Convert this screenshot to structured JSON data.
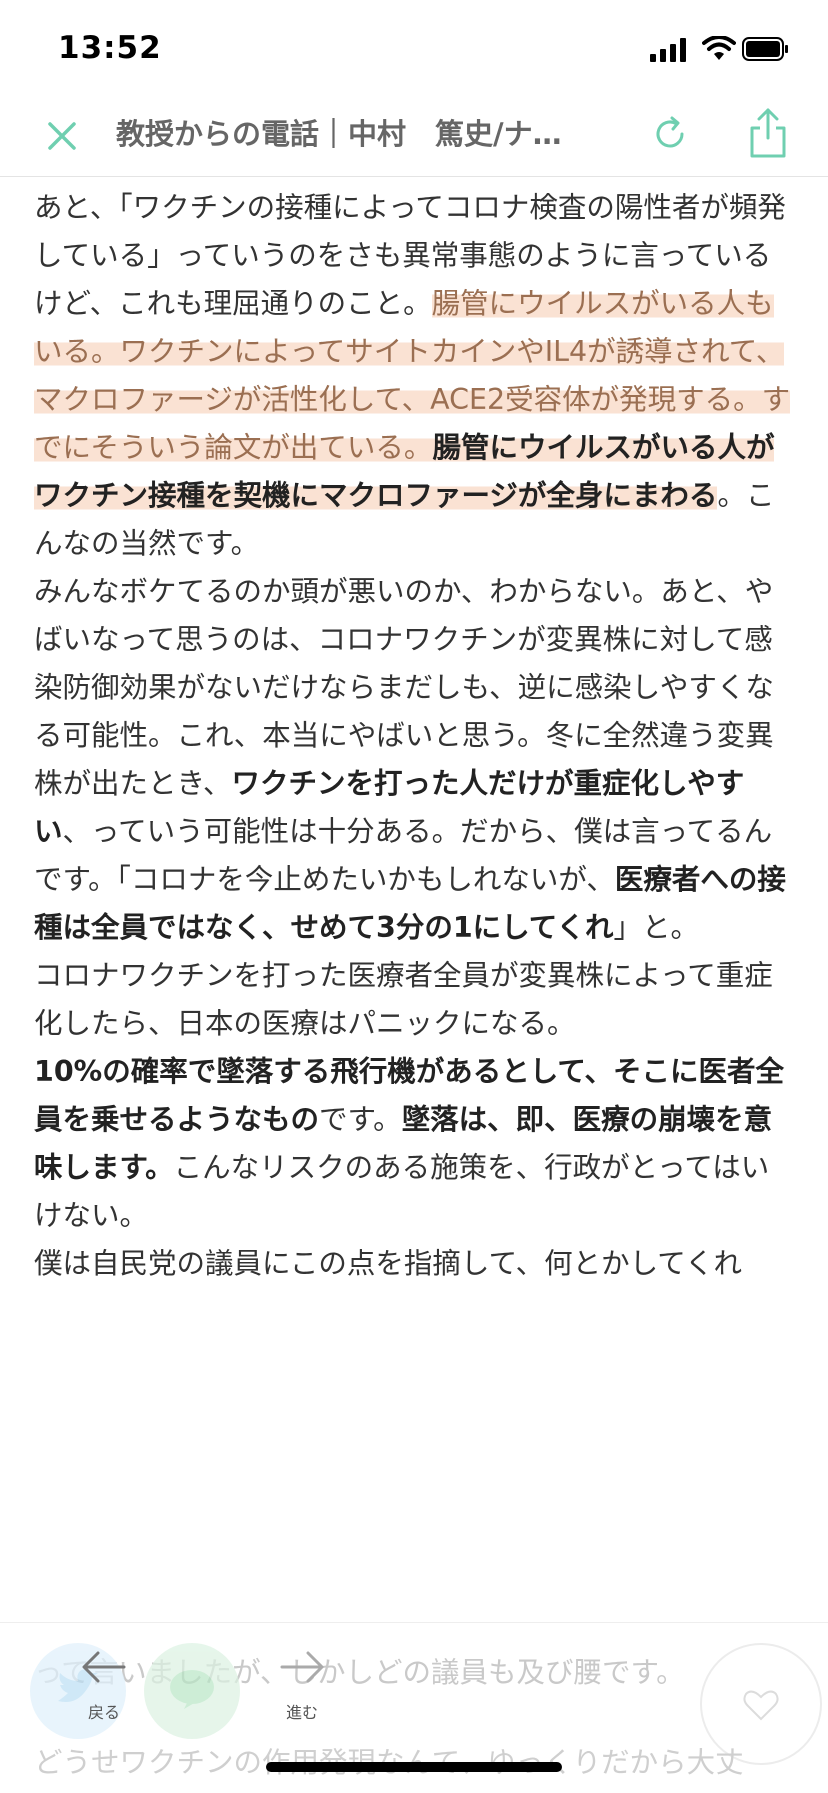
{
  "status_bar": {
    "time": "13:52"
  },
  "nav": {
    "title": "教授からの電話｜中村　篤史/ナ…"
  },
  "article": {
    "p1": {
      "a": "あと、「ワクチンの接種によってコロナ検査の陽性者が頻発している」っていうのをさも異常事態のように言っているけど、これも理屈通りのこと。",
      "b": "腸管にウイルスがいる人もいる。ワクチンによってサイトカインやIL4が誘導されて、マクロファージが活性化して、ACE2受容体が発現する。すでにそういう論文が出ている。",
      "c": "腸管にウイルスがいる人がワクチン接種を契機にマクロファージが全身にまわる",
      "d": "。こんなの当然です。"
    },
    "p2": {
      "a": "みんなボケてるのか頭が悪いのか、わからない。あと、やばいなって思うのは、コロナワクチンが変異株に対して感染防御効果がないだけならまだしも、逆に感染しやすくなる可能性。これ、本当にやばいと思う。冬に全然違う変異株が出たとき、",
      "b": "ワクチンを打った人だけが重症化しやすい",
      "c": "、っていう可能性は十分ある。だから、僕は言ってるんです。「コロナを今止めたいかもしれないが、",
      "d": "医療者への接種は全員ではなく、せめて3分の1にしてくれ",
      "e": "」と。"
    },
    "p3": "コロナワクチンを打った医療者全員が変異株によって重症化したら、日本の医療はパニックになる。",
    "p4": {
      "a": "10%の確率で墜落する飛行機があるとして、そこに医者全員を乗せるようなもの",
      "b": "です。",
      "c": "墜落は、即、医療の崩壊を意味します。",
      "d": "こんなリスクのある施策を、行政がとってはいけない。"
    },
    "p5": "僕は自民党の議員にこの点を指摘して、何とかしてくれ",
    "ghost_line1": "って言いましたが、しかしどの議員も及び腰です。",
    "ghost_line2": "どうせワクチンの作用発現なんて、ゆっくりだから大丈"
  },
  "toolbar": {
    "back_label": "戻る",
    "forward_label": "進む"
  },
  "icons": {
    "close": "close-icon",
    "reload": "reload-icon",
    "share": "share-icon",
    "back": "arrow-left-icon",
    "forward": "arrow-right-icon",
    "like": "heart-icon",
    "twitter": "twitter-icon",
    "line": "line-icon"
  },
  "colors": {
    "accent": "#6fcfb0",
    "highlight": "#f6ceb6"
  }
}
